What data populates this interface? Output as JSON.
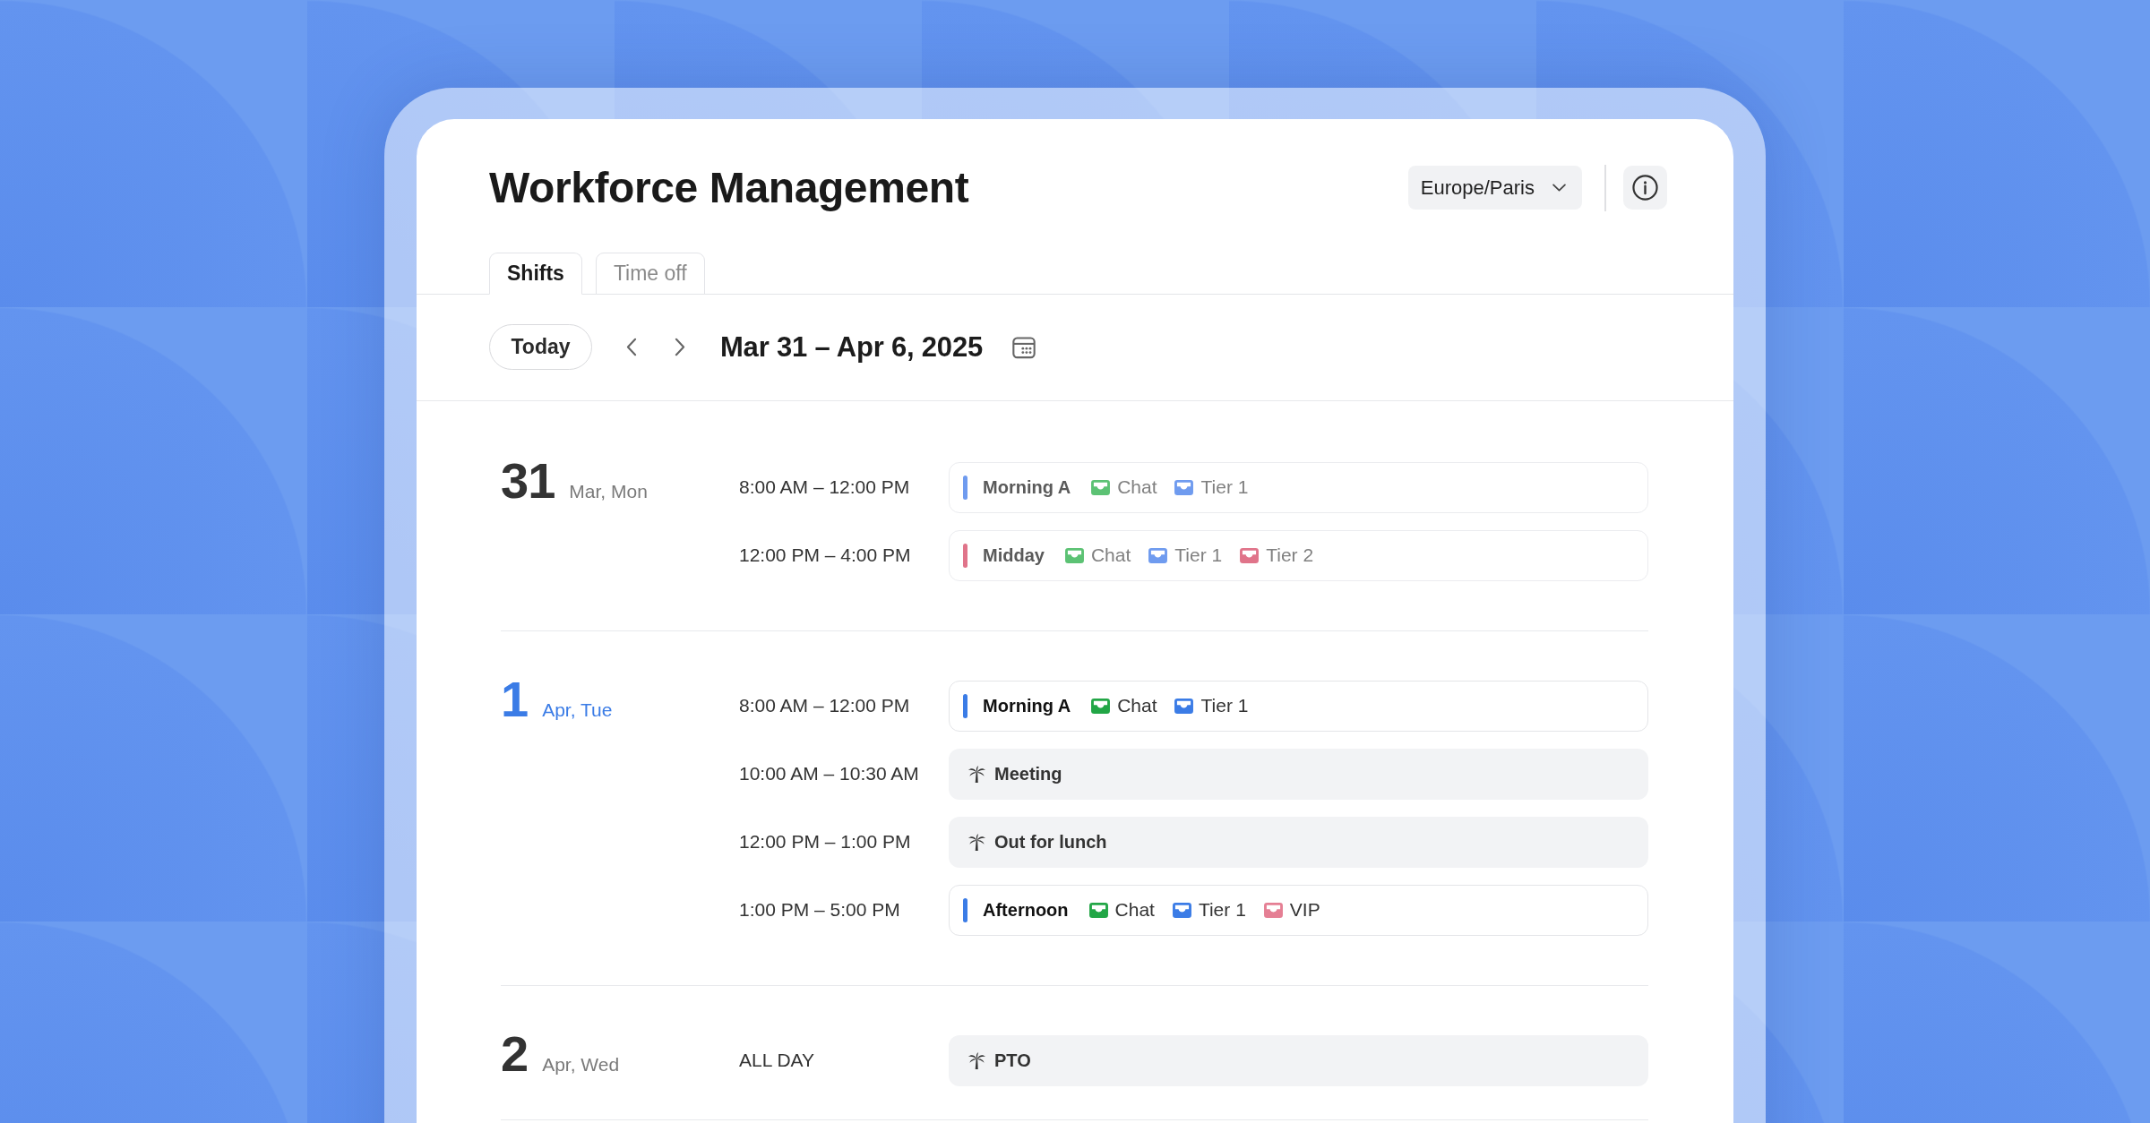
{
  "header": {
    "title": "Workforce Management",
    "timezone": "Europe/Paris"
  },
  "tabs": [
    {
      "label": "Shifts",
      "selected": true
    },
    {
      "label": "Time off",
      "selected": false
    }
  ],
  "toolbar": {
    "today_button": "Today",
    "date_range": "Mar 31 – Apr 6, 2025"
  },
  "days": [
    {
      "day": "31",
      "label": "Mar, Mon",
      "today": false,
      "past": true,
      "entries": [
        {
          "kind": "shift",
          "time": "8:00 AM – 12:00 PM",
          "name": "Morning A",
          "color": "#6f9bef",
          "tags": [
            {
              "label": "Chat",
              "color": "#5cc274"
            },
            {
              "label": "Tier 1",
              "color": "#6f9bef"
            }
          ]
        },
        {
          "kind": "shift",
          "time": "12:00 PM – 4:00 PM",
          "name": "Midday",
          "color": "#e0748a",
          "tags": [
            {
              "label": "Chat",
              "color": "#5cc274"
            },
            {
              "label": "Tier 1",
              "color": "#6f9bef"
            },
            {
              "label": "Tier 2",
              "color": "#e0748a"
            }
          ]
        }
      ]
    },
    {
      "day": "1",
      "label": "Apr, Tue",
      "today": true,
      "past": false,
      "entries": [
        {
          "kind": "shift",
          "time": "8:00 AM – 12:00 PM",
          "name": "Morning A",
          "color": "#3b7ce6",
          "tags": [
            {
              "label": "Chat",
              "color": "#22a646"
            },
            {
              "label": "Tier 1",
              "color": "#3b7ce6"
            }
          ]
        },
        {
          "kind": "time_off",
          "time": "10:00 AM – 10:30 AM",
          "name": "Meeting"
        },
        {
          "kind": "time_off",
          "time": "12:00 PM – 1:00 PM",
          "name": "Out for lunch"
        },
        {
          "kind": "shift",
          "time": "1:00 PM – 5:00 PM",
          "name": "Afternoon",
          "color": "#3b7ce6",
          "tags": [
            {
              "label": "Chat",
              "color": "#22a646"
            },
            {
              "label": "Tier 1",
              "color": "#3b7ce6"
            },
            {
              "label": "VIP",
              "color": "#e57f94"
            }
          ]
        }
      ]
    },
    {
      "day": "2",
      "label": "Apr, Wed",
      "today": false,
      "past": false,
      "entries": [
        {
          "kind": "time_off",
          "time": "ALL DAY",
          "name": "PTO"
        }
      ]
    }
  ]
}
